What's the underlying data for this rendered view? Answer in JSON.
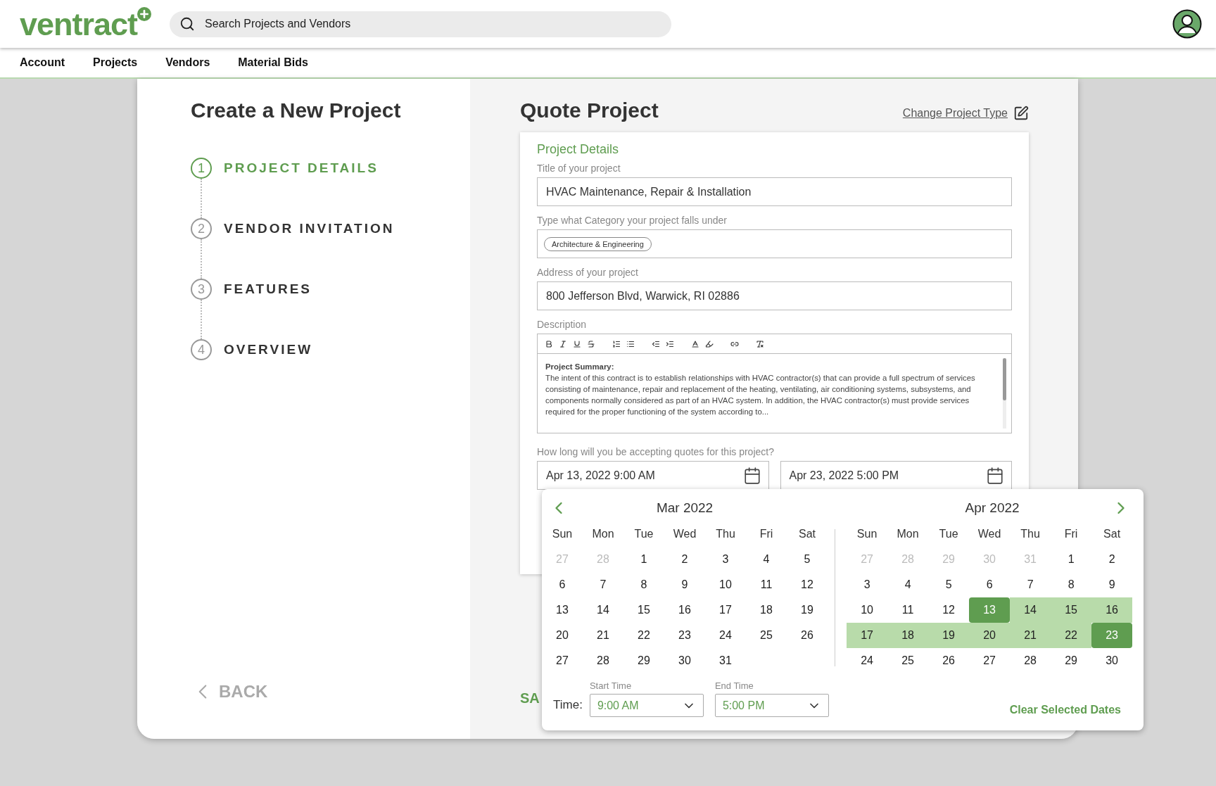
{
  "header": {
    "logo": "ventract",
    "search": {
      "placeholder": "Search Projects and Vendors"
    }
  },
  "nav": [
    "Account",
    "Projects",
    "Vendors",
    "Material Bids"
  ],
  "sidebar": {
    "title": "Create a New Project",
    "steps": [
      {
        "number": "1",
        "label": "PROJECT DETAILS",
        "selected": true
      },
      {
        "number": "2",
        "label": "VENDOR INVITATION",
        "selected": false
      },
      {
        "number": "3",
        "label": "FEATURES",
        "selected": false
      },
      {
        "number": "4",
        "label": "OVERVIEW",
        "selected": false
      }
    ],
    "back": "BACK"
  },
  "main": {
    "title": "Quote Project",
    "change_link": "Change Project Type",
    "section_title": "Project Details",
    "fields": [
      {
        "kind": "text",
        "label": "Title of your project",
        "value": "HVAC Maintenance, Repair & Installation"
      },
      {
        "kind": "tags",
        "label": "Type what Category your project falls under",
        "tags": [
          "Architecture & Engineering"
        ]
      },
      {
        "kind": "text",
        "label": "Address of your project",
        "value": "800 Jefferson Blvd, Warwick, RI 02886"
      },
      {
        "kind": "editor",
        "label": "Description",
        "heading": "Project Summary:",
        "body": "The intent of this contract is to establish relationships with HVAC contractor(s) that can provide a full spectrum of services consisting of maintenance, repair and replacement of the heating, ventilating, air conditioning systems, subsystems, and components normally considered as part of an HVAC system. In addition, the HVAC contractor(s) must provide services required for the proper functioning of the system according to..."
      }
    ],
    "quote_period": {
      "label": "How long will you be accepting quotes for this project?",
      "start": "Apr 13, 2022 9:00 AM",
      "end": "Apr 23, 2022 5:00 PM"
    },
    "save": "SA"
  },
  "date_picker": {
    "months": [
      {
        "title": "Mar 2022",
        "weekdays": [
          "Sun",
          "Mon",
          "Tue",
          "Wed",
          "Thu",
          "Fri",
          "Sat"
        ],
        "weeks": [
          [
            {
              "d": "27",
              "outside": true,
              "selected": false,
              "in_range": false
            },
            {
              "d": "28",
              "outside": true,
              "selected": false,
              "in_range": false
            },
            {
              "d": "1",
              "outside": false,
              "selected": false,
              "in_range": false
            },
            {
              "d": "2",
              "outside": false,
              "selected": false,
              "in_range": false
            },
            {
              "d": "3",
              "outside": false,
              "selected": false,
              "in_range": false
            },
            {
              "d": "4",
              "outside": false,
              "selected": false,
              "in_range": false
            },
            {
              "d": "5",
              "outside": false,
              "selected": false,
              "in_range": false
            }
          ],
          [
            {
              "d": "6",
              "outside": false,
              "selected": false,
              "in_range": false
            },
            {
              "d": "7",
              "outside": false,
              "selected": false,
              "in_range": false
            },
            {
              "d": "8",
              "outside": false,
              "selected": false,
              "in_range": false
            },
            {
              "d": "9",
              "outside": false,
              "selected": false,
              "in_range": false
            },
            {
              "d": "10",
              "outside": false,
              "selected": false,
              "in_range": false
            },
            {
              "d": "11",
              "outside": false,
              "selected": false,
              "in_range": false
            },
            {
              "d": "12",
              "outside": false,
              "selected": false,
              "in_range": false
            }
          ],
          [
            {
              "d": "13",
              "outside": false,
              "selected": false,
              "in_range": false
            },
            {
              "d": "14",
              "outside": false,
              "selected": false,
              "in_range": false
            },
            {
              "d": "15",
              "outside": false,
              "selected": false,
              "in_range": false
            },
            {
              "d": "16",
              "outside": false,
              "selected": false,
              "in_range": false
            },
            {
              "d": "17",
              "outside": false,
              "selected": false,
              "in_range": false
            },
            {
              "d": "18",
              "outside": false,
              "selected": false,
              "in_range": false
            },
            {
              "d": "19",
              "outside": false,
              "selected": false,
              "in_range": false
            }
          ],
          [
            {
              "d": "20",
              "outside": false,
              "selected": false,
              "in_range": false
            },
            {
              "d": "21",
              "outside": false,
              "selected": false,
              "in_range": false
            },
            {
              "d": "22",
              "outside": false,
              "selected": false,
              "in_range": false
            },
            {
              "d": "23",
              "outside": false,
              "selected": false,
              "in_range": false
            },
            {
              "d": "24",
              "outside": false,
              "selected": false,
              "in_range": false
            },
            {
              "d": "25",
              "outside": false,
              "selected": false,
              "in_range": false
            },
            {
              "d": "26",
              "outside": false,
              "selected": false,
              "in_range": false
            }
          ],
          [
            {
              "d": "27",
              "outside": false,
              "selected": false,
              "in_range": false
            },
            {
              "d": "28",
              "outside": false,
              "selected": false,
              "in_range": false
            },
            {
              "d": "29",
              "outside": false,
              "selected": false,
              "in_range": false
            },
            {
              "d": "30",
              "outside": false,
              "selected": false,
              "in_range": false
            },
            {
              "d": "31",
              "outside": false,
              "selected": false,
              "in_range": false
            }
          ]
        ]
      },
      {
        "title": "Apr 2022",
        "weekdays": [
          "Sun",
          "Mon",
          "Tue",
          "Wed",
          "Thu",
          "Fri",
          "Sat"
        ],
        "weeks": [
          [
            {
              "d": "27",
              "outside": true,
              "selected": false,
              "in_range": false
            },
            {
              "d": "28",
              "outside": true,
              "selected": false,
              "in_range": false
            },
            {
              "d": "29",
              "outside": true,
              "selected": false,
              "in_range": false
            },
            {
              "d": "30",
              "outside": true,
              "selected": false,
              "in_range": false
            },
            {
              "d": "31",
              "outside": true,
              "selected": false,
              "in_range": false
            },
            {
              "d": "1",
              "outside": false,
              "selected": false,
              "in_range": false
            },
            {
              "d": "2",
              "outside": false,
              "selected": false,
              "in_range": false
            }
          ],
          [
            {
              "d": "3",
              "outside": false,
              "selected": false,
              "in_range": false
            },
            {
              "d": "4",
              "outside": false,
              "selected": false,
              "in_range": false
            },
            {
              "d": "5",
              "outside": false,
              "selected": false,
              "in_range": false
            },
            {
              "d": "6",
              "outside": false,
              "selected": false,
              "in_range": false
            },
            {
              "d": "7",
              "outside": false,
              "selected": false,
              "in_range": false
            },
            {
              "d": "8",
              "outside": false,
              "selected": false,
              "in_range": false
            },
            {
              "d": "9",
              "outside": false,
              "selected": false,
              "in_range": false
            }
          ],
          [
            {
              "d": "10",
              "outside": false,
              "selected": false,
              "in_range": false
            },
            {
              "d": "11",
              "outside": false,
              "selected": false,
              "in_range": false
            },
            {
              "d": "12",
              "outside": false,
              "selected": false,
              "in_range": false
            },
            {
              "d": "13",
              "outside": false,
              "selected": true,
              "in_range": false
            },
            {
              "d": "14",
              "outside": false,
              "selected": false,
              "in_range": true
            },
            {
              "d": "15",
              "outside": false,
              "selected": false,
              "in_range": true
            },
            {
              "d": "16",
              "outside": false,
              "selected": false,
              "in_range": true
            }
          ],
          [
            {
              "d": "17",
              "outside": false,
              "selected": false,
              "in_range": true
            },
            {
              "d": "18",
              "outside": false,
              "selected": false,
              "in_range": true
            },
            {
              "d": "19",
              "outside": false,
              "selected": false,
              "in_range": true
            },
            {
              "d": "20",
              "outside": false,
              "selected": false,
              "in_range": true
            },
            {
              "d": "21",
              "outside": false,
              "selected": false,
              "in_range": true
            },
            {
              "d": "22",
              "outside": false,
              "selected": false,
              "in_range": true
            },
            {
              "d": "23",
              "outside": false,
              "selected": true,
              "in_range": false
            }
          ],
          [
            {
              "d": "24",
              "outside": false,
              "selected": false,
              "in_range": false
            },
            {
              "d": "25",
              "outside": false,
              "selected": false,
              "in_range": false
            },
            {
              "d": "26",
              "outside": false,
              "selected": false,
              "in_range": false
            },
            {
              "d": "27",
              "outside": false,
              "selected": false,
              "in_range": false
            },
            {
              "d": "28",
              "outside": false,
              "selected": false,
              "in_range": false
            },
            {
              "d": "29",
              "outside": false,
              "selected": false,
              "in_range": false
            },
            {
              "d": "30",
              "outside": false,
              "selected": false,
              "in_range": false
            }
          ]
        ]
      }
    ],
    "time_label": "Time:",
    "start_time": {
      "label": "Start Time",
      "value": "9:00 AM"
    },
    "end_time": {
      "label": "End Time",
      "value": "5:00 PM"
    },
    "clear": "Clear Selected Dates"
  }
}
